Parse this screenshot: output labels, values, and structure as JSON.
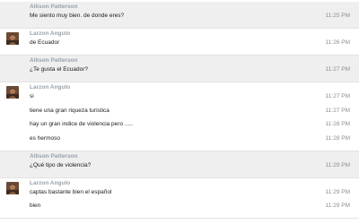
{
  "messages": [
    {
      "sender": "Allison Patterson",
      "avatar": false,
      "alt": true,
      "lines": [
        {
          "text": "Me siento muy bien. de donde eres?",
          "time": "11:25 PM"
        }
      ]
    },
    {
      "sender": "Larzon Angulo",
      "avatar": true,
      "alt": false,
      "lines": [
        {
          "text": "de Ecuador",
          "time": "11:26 PM"
        }
      ]
    },
    {
      "sender": "Allison Patterson",
      "avatar": false,
      "alt": true,
      "lines": [
        {
          "text": "¿Te gusta el Ecuador?",
          "time": "11:27 PM"
        }
      ]
    },
    {
      "sender": "Larzon Angulo",
      "avatar": true,
      "alt": false,
      "lines": [
        {
          "text": "si",
          "time": "11:27 PM"
        },
        {
          "text": "tiene una gran riqueza turistica",
          "time": "11:27 PM"
        },
        {
          "text": "hay un gran indice de violencia pero .....",
          "time": "11:28 PM"
        },
        {
          "text": "es hermoso",
          "time": "11:28 PM"
        }
      ]
    },
    {
      "sender": "Allison Patterson",
      "avatar": false,
      "alt": true,
      "lines": [
        {
          "text": "¿Qué tipo de violencia?",
          "time": "11:29 PM"
        }
      ]
    },
    {
      "sender": "Larzon Angulo",
      "avatar": true,
      "alt": false,
      "lines": [
        {
          "text": "captas bastante bien el español",
          "time": "11:29 PM"
        },
        {
          "text": "bien",
          "time": "11:29 PM"
        }
      ]
    }
  ]
}
